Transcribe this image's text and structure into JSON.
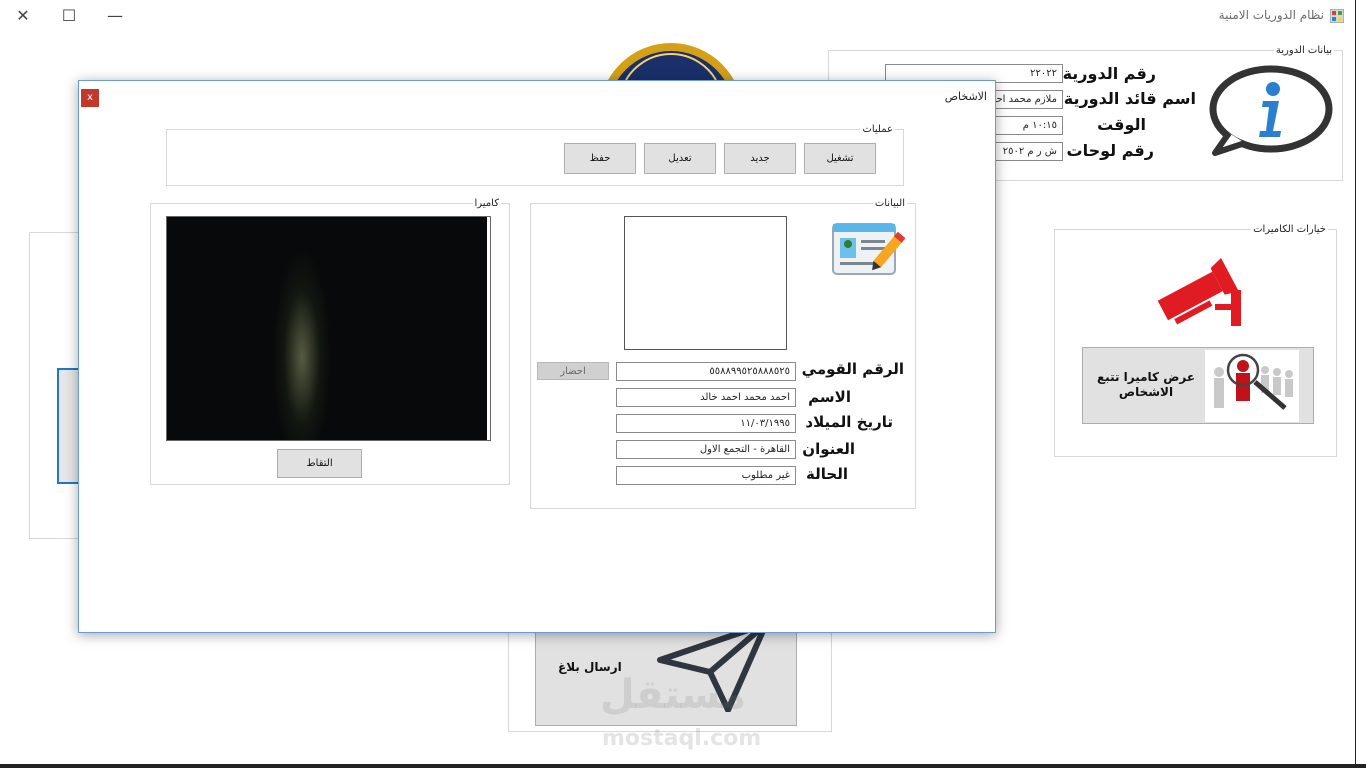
{
  "window": {
    "title": "نظام الدوريات الامنية",
    "controls": {
      "close": "✕",
      "maximize": "☐",
      "minimize": "—"
    }
  },
  "patrol_panel": {
    "title": "بيانات الدورية",
    "patrol_number_label": "رقم الدورية",
    "patrol_number_value": "٢٢٠٢٢",
    "leader_label": "اسم قائد الدورية",
    "leader_value": "ملازم محمد احمد",
    "time_label": "الوقت",
    "time_value": "١٠:١٥ م",
    "plates_label": "رقم لوحات",
    "plates_value": "ش ر م ٢٥٠٢"
  },
  "camera_options_panel": {
    "title": "خيارات الكاميرات",
    "tracking_button_label": "عرض كاميرا تتبع الاشخاص"
  },
  "report_button": {
    "label": "ارسال بلاغ"
  },
  "watermark": {
    "arabic": "مستقل",
    "latin": "mostaql.com"
  },
  "dialog": {
    "title": "الاشخاص",
    "close_label": "x",
    "operations": {
      "title": "عمليات",
      "buttons": [
        {
          "label": "تشغيل"
        },
        {
          "label": "جديد"
        },
        {
          "label": "تعديل"
        },
        {
          "label": "حفظ"
        }
      ]
    },
    "data_group": {
      "title": "البيانات",
      "fields": [
        {
          "label": "الرقم القومي",
          "value": "٥٥٨٨٩٩٥٢٥٨٨٨٥٢٥"
        },
        {
          "label": "الاسم",
          "value": "احمد محمد احمد خالد"
        },
        {
          "label": "تاريخ الميلاد",
          "value": "١١/٠٣/١٩٩٥"
        },
        {
          "label": "العنوان",
          "value": "القاهرة - التجمع الاول"
        },
        {
          "label": "الحالة",
          "value": "غير مطلوب"
        }
      ],
      "fetch_button_label": "احضار"
    },
    "camera_group": {
      "title": "كاميرا",
      "capture_button_label": "التقاط"
    }
  },
  "colors": {
    "accent_blue": "#1e78c8",
    "camera_red": "#e11b22",
    "info_icon_blue": "#2a7fcf",
    "dialog_close_red": "#c0392b"
  }
}
